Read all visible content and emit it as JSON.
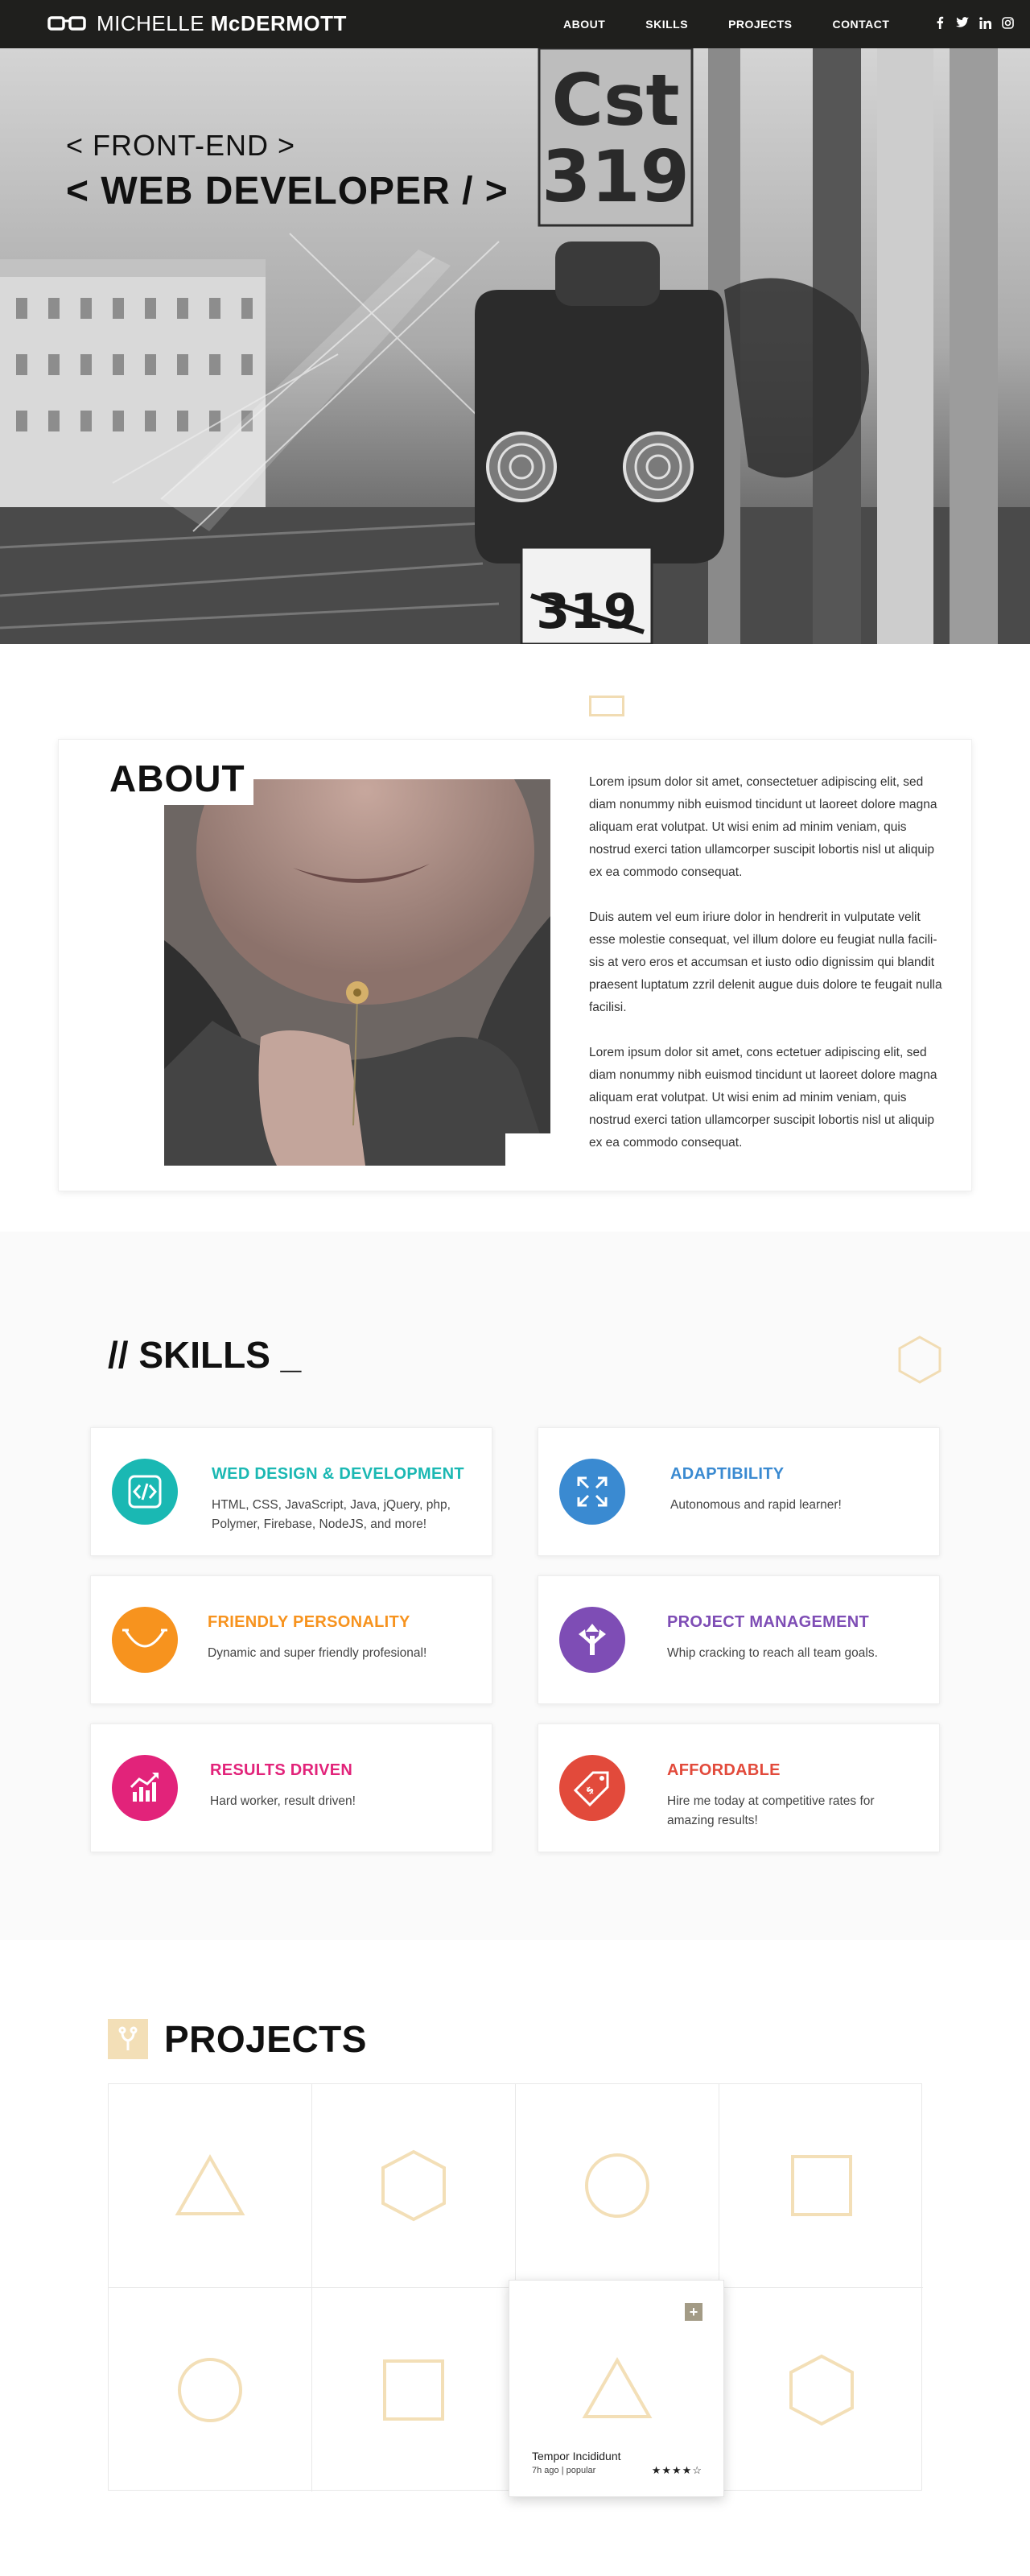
{
  "header": {
    "brand_first": "MICHELLE ",
    "brand_last": "McDERMOTT",
    "nav": [
      "ABOUT",
      "SKILLS",
      "PROJECTS",
      "CONTACT"
    ],
    "social": [
      "facebook-icon",
      "twitter-icon",
      "linkedin-icon",
      "instagram-icon"
    ]
  },
  "hero": {
    "line1": "< FRONT-END >",
    "line2": "< WEB DEVELOPER / >",
    "sign_top_1": "Cst",
    "sign_top_2": "319",
    "sign_bottom": "319"
  },
  "about": {
    "title": "ABOUT",
    "paragraphs": [
      "Lorem ipsum dolor sit amet, consectetuer adipiscing elit, sed diam nonummy nibh euismod tincidunt ut laoreet dolore magna aliquam erat volutpat. Ut wisi enim ad minim veniam, quis nostrud exerci tation ullamcorper suscipit lobortis nisl ut aliquip ex ea commodo consequat.",
      "Duis autem vel eum iriure dolor in hendrerit in vulputate velit esse molestie consequat, vel illum dolore eu feugiat nulla facili-sis at vero eros et accumsan et iusto odio dignissim qui blandit praesent luptatum zzril delenit augue duis dolore te feugait nulla facilisi.",
      "Lorem ipsum dolor sit amet, cons ectetuer adipiscing elit, sed diam nonummy nibh euismod tincidunt ut laoreet dolore magna aliquam erat volutpat. Ut wisi enim ad minim veniam, quis nostrud exerci tation ullamcorper suscipit lobortis nisl ut aliquip ex ea commodo consequat."
    ]
  },
  "skills": {
    "title": "// SKILLS _",
    "items": [
      {
        "title": "WED DESIGN & DEVELOPMENT",
        "desc": "HTML, CSS, JavaScript, Java, jQuery, php, Polymer, Firebase, NodeJS, and more!",
        "color": "#1ab8b3",
        "icon": "code-icon"
      },
      {
        "title": "ADAPTIBILITY",
        "desc": "Autonomous and rapid learner!",
        "color": "#3a8ad1",
        "icon": "expand-arrows-icon"
      },
      {
        "title": "FRIENDLY PERSONALITY",
        "desc": "Dynamic and super friendly profesional!",
        "color": "#f7931e",
        "icon": "smile-icon"
      },
      {
        "title": "PROJECT MANAGEMENT",
        "desc": "Whip cracking to reach all team goals.",
        "color": "#7e4db5",
        "icon": "split-arrows-icon"
      },
      {
        "title": "RESULTS DRIVEN",
        "desc": "Hard worker, result driven!",
        "color": "#e2237a",
        "icon": "bar-chart-icon"
      },
      {
        "title": "AFFORDABLE",
        "desc": "Hire me today at competitive rates for amazing results!",
        "color": "#e24a3b",
        "icon": "price-tag-icon"
      }
    ]
  },
  "projects": {
    "title": "PROJECTS",
    "shape_color": "#f3dfb7",
    "cells": [
      "triangle",
      "hexagon",
      "circle",
      "square",
      "circle",
      "square",
      "triangle",
      "hexagon"
    ],
    "popup": {
      "name": "Tempor Incididunt",
      "meta": "7h ago | popular",
      "plus": "+",
      "stars": "★★★★☆"
    }
  }
}
